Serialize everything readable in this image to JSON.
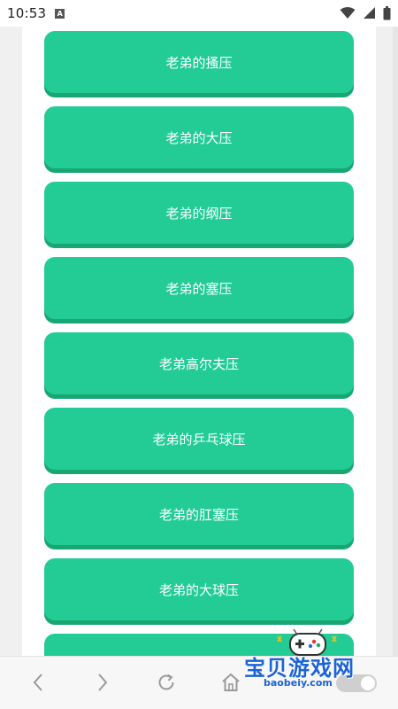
{
  "status_bar": {
    "time": "10:53",
    "a_icon": "A"
  },
  "buttons": [
    "老弟的搔压",
    "老弟的大压",
    "老弟的纲压",
    "老弟的塞压",
    "老弟高尔夫压",
    "老弟的乒乓球压",
    "老弟的肛塞压",
    "老弟的大球压",
    ""
  ],
  "bottom_nav": {
    "icons": [
      "back-icon",
      "forward-icon",
      "refresh-icon",
      "home-icon"
    ]
  },
  "watermark": {
    "title": "宝贝游戏网",
    "domain": "baobeiy.com"
  },
  "colors": {
    "button": "#22cc94",
    "button_shadow": "#18a673",
    "watermark": "#1b63d6"
  }
}
